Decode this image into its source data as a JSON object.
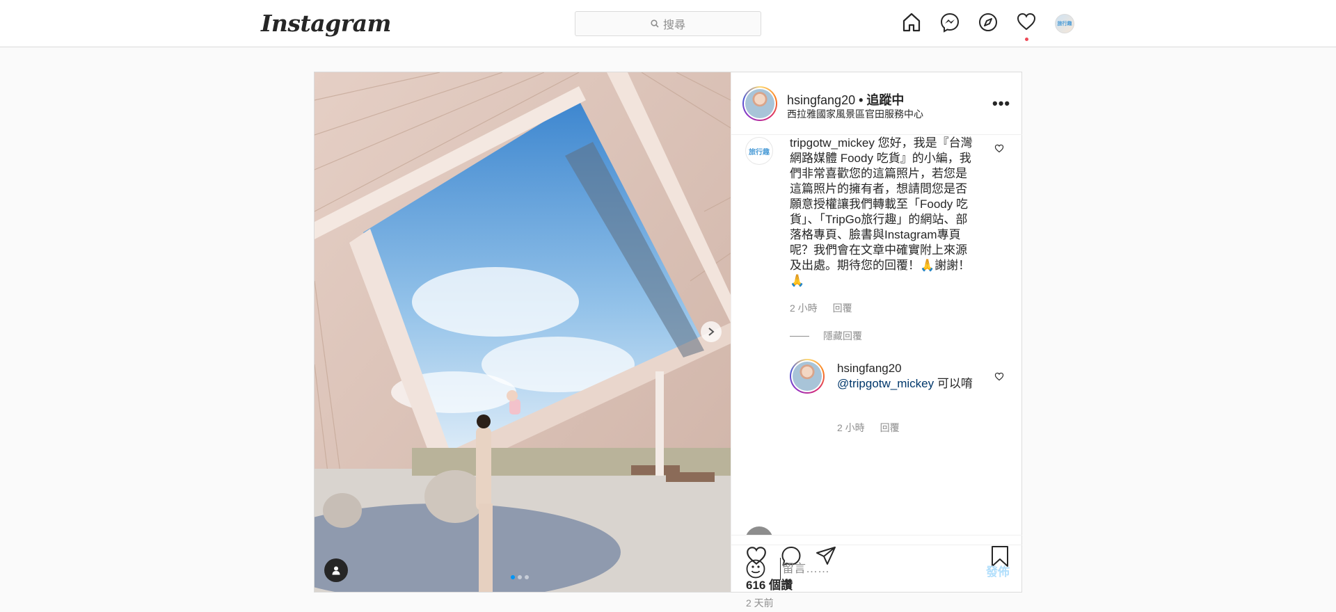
{
  "nav": {
    "logo": "Instagram",
    "search_placeholder": "搜尋",
    "icons": [
      "home-icon",
      "messenger-icon",
      "explore-icon",
      "activity-heart-icon",
      "profile-avatar"
    ]
  },
  "post": {
    "username": "hsingfang20",
    "follow_status": "• 追蹤中",
    "location": "西拉雅國家風景區官田服務中心",
    "more": "•••",
    "carousel": {
      "current_index": 1,
      "total": 3
    },
    "comments": [
      {
        "username": "tripgotw_mickey",
        "avatar_text": "旅行趣",
        "text": "您好，我是『台灣網路媒體 Foody 吃貨』的小編，我們非常喜歡您的這篇照片，若您是這篇照片的擁有者，想請問您是否願意授權讓我們轉載至「Foody 吃貨」、「TripGo旅行趣」的網站、部落格專頁、臉書與Instagram專頁呢？我們會在文章中確實附上來源及出處。期待您的回覆！🙏謝謝！🙏",
        "time": "2 小時",
        "reply_label": "回覆"
      }
    ],
    "hide_replies": "隱藏回覆",
    "reply": {
      "username": "hsingfang20",
      "mention": "@tripgotw_mickey",
      "text": " 可以唷",
      "time": "2 小時",
      "reply_label": "回覆"
    },
    "likes": "616 個讚",
    "posted": "2 天前",
    "comment_placeholder": "留言……",
    "post_button": "發佈"
  },
  "colors": {
    "accent_blue": "#0095f6",
    "post_button_disabled": "#b2dffc",
    "notification": "#ed4956"
  }
}
